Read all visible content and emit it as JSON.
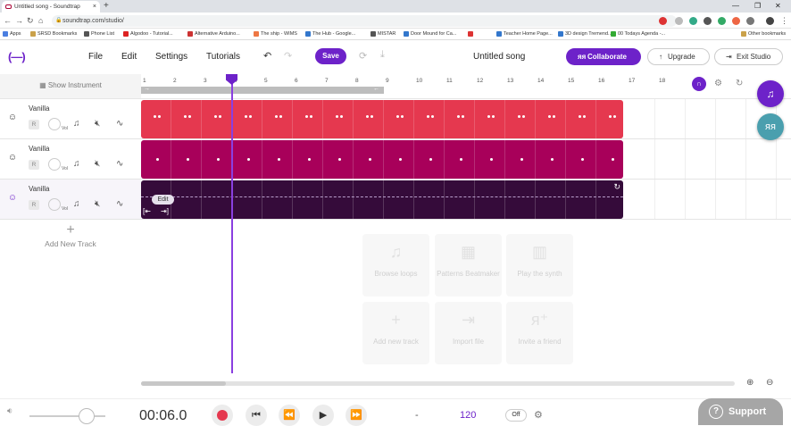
{
  "browser": {
    "tab_title": "Untitled song - Soundtrap",
    "tab_close": "×",
    "new_tab": "+",
    "url": "soundtrap.com/studio/",
    "bookmarks": [
      "Apps",
      "SRSD Bookmarks",
      "Phone List",
      "Algodoo - Tutorial...",
      "Alternative Arduino...",
      "The ship - WIMS",
      "The Hub - Google...",
      "MISTAR",
      "Door Mound for Ca...",
      "",
      "Teacher Home Page...",
      "3D design Tremend...",
      "00 Todays Agenda -...",
      "Other bookmarks"
    ]
  },
  "header": {
    "logo": "(—)",
    "menu": [
      "File",
      "Edit",
      "Settings",
      "Tutorials"
    ],
    "save_label": "Save",
    "song_title": "Untitled song",
    "collaborate_label": "Collaborate",
    "upgrade_label": "Upgrade",
    "exit_label": "Exit Studio"
  },
  "left_panel": {
    "show_instrument": "Show Instrument",
    "tracks": [
      {
        "name": "Vanilla",
        "r": "R",
        "vol": "Vol"
      },
      {
        "name": "Vanilla",
        "r": "R",
        "vol": "Vol"
      },
      {
        "name": "Vanilla",
        "r": "R",
        "vol": "Vol"
      }
    ],
    "add_track_plus": "+",
    "add_track": "Add New Track"
  },
  "ruler": {
    "numbers": [
      "1",
      "2",
      "3",
      "4",
      "5",
      "6",
      "7",
      "8",
      "9",
      "10",
      "11",
      "12",
      "13",
      "14",
      "15",
      "16",
      "17",
      "18"
    ]
  },
  "regions": {
    "colors": [
      "#e5384f",
      "#a8005a",
      "#350b3a"
    ],
    "edit_label": "Edit"
  },
  "empty_tiles": [
    {
      "label": "Browse loops",
      "icon": "music-note-icon"
    },
    {
      "label": "Patterns Beatmaker",
      "icon": "grid-icon"
    },
    {
      "label": "Play the synth",
      "icon": "piano-icon"
    },
    {
      "label": "Add new track",
      "icon": "plus-icon"
    },
    {
      "label": "Import file",
      "icon": "import-icon"
    },
    {
      "label": "Invite a friend",
      "icon": "invite-icon"
    }
  ],
  "transport": {
    "time": "00:06.0",
    "tempo_dash": "-",
    "tempo": "120",
    "metronome": "Off",
    "support": "Support"
  },
  "colors": {
    "accent": "#6d22c9",
    "teal": "#4a9fae"
  }
}
